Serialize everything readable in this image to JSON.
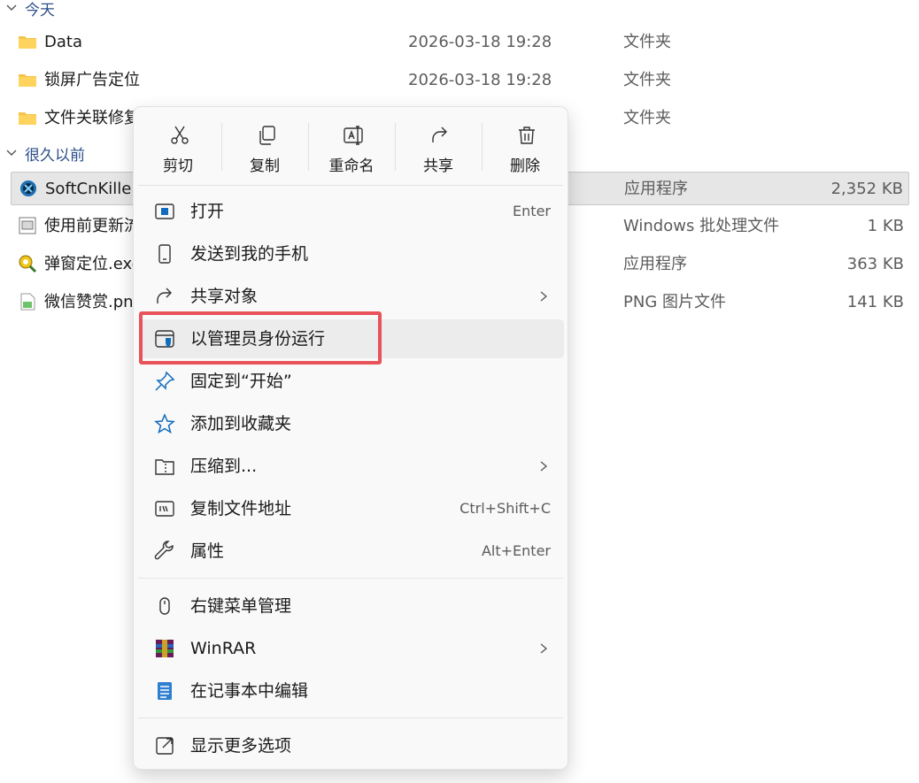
{
  "file_list": {
    "groups": [
      {
        "label": "今天"
      },
      {
        "label": "很久以前"
      }
    ],
    "files": [
      {
        "name": "Data",
        "date": "2026-03-18 19:28",
        "type": "文件夹",
        "size": "",
        "icon": "folder-icon"
      },
      {
        "name": "锁屏广告定位",
        "date": "2026-03-18 19:28",
        "type": "文件夹",
        "size": "",
        "icon": "folder-icon"
      },
      {
        "name": "文件关联修复",
        "date": "",
        "type": "文件夹",
        "size": "",
        "icon": "folder-icon"
      },
      {
        "name": "SoftCnKiller",
        "date": "",
        "type": "应用程序",
        "size": "2,352 KB",
        "icon": "app-icon",
        "selected": true
      },
      {
        "name": "使用前更新流",
        "date": "",
        "type": "Windows 批处理文件",
        "size": "1 KB",
        "icon": "batch-file-icon"
      },
      {
        "name": "弹窗定位.exe",
        "date": "",
        "type": "应用程序",
        "size": "363 KB",
        "icon": "exe-icon"
      },
      {
        "name": "微信赞赏.png",
        "date": "",
        "type": "PNG 图片文件",
        "size": "141 KB",
        "icon": "png-file-icon"
      }
    ]
  },
  "context_menu": {
    "toolbar": [
      {
        "label": "剪切",
        "icon": "scissors-icon"
      },
      {
        "label": "复制",
        "icon": "copy-icon"
      },
      {
        "label": "重命名",
        "icon": "rename-icon"
      },
      {
        "label": "共享",
        "icon": "share-icon"
      },
      {
        "label": "删除",
        "icon": "trash-icon"
      }
    ],
    "items": [
      {
        "label": "打开",
        "shortcut": "Enter",
        "icon": "open-window-icon"
      },
      {
        "label": "发送到我的手机",
        "shortcut": "",
        "icon": "phone-icon"
      },
      {
        "label": "共享对象",
        "shortcut": "",
        "icon": "share-icon",
        "submenu": true
      },
      {
        "label": "以管理员身份运行",
        "shortcut": "",
        "icon": "admin-shield-icon",
        "hovered": true,
        "highlighted": true
      },
      {
        "label": "固定到“开始”",
        "shortcut": "",
        "icon": "pin-icon"
      },
      {
        "label": "添加到收藏夹",
        "shortcut": "",
        "icon": "star-icon"
      },
      {
        "label": "压缩到...",
        "shortcut": "",
        "icon": "zip-folder-icon",
        "submenu": true
      },
      {
        "label": "复制文件地址",
        "shortcut": "Ctrl+Shift+C",
        "icon": "copy-path-icon"
      },
      {
        "label": "属性",
        "shortcut": "Alt+Enter",
        "icon": "wrench-icon"
      },
      {
        "label": "右键菜单管理",
        "shortcut": "",
        "icon": "mouse-icon"
      },
      {
        "label": "WinRAR",
        "shortcut": "",
        "icon": "winrar-icon",
        "submenu": true
      },
      {
        "label": "在记事本中编辑",
        "shortcut": "",
        "icon": "notepad-icon"
      },
      {
        "label": "显示更多选项",
        "shortcut": "",
        "icon": "show-more-icon"
      }
    ]
  },
  "colors": {
    "highlight": "#e8525a",
    "accent": "#0f6cbd",
    "folder": "#f4c34a",
    "group_header": "#2b4f8a"
  }
}
